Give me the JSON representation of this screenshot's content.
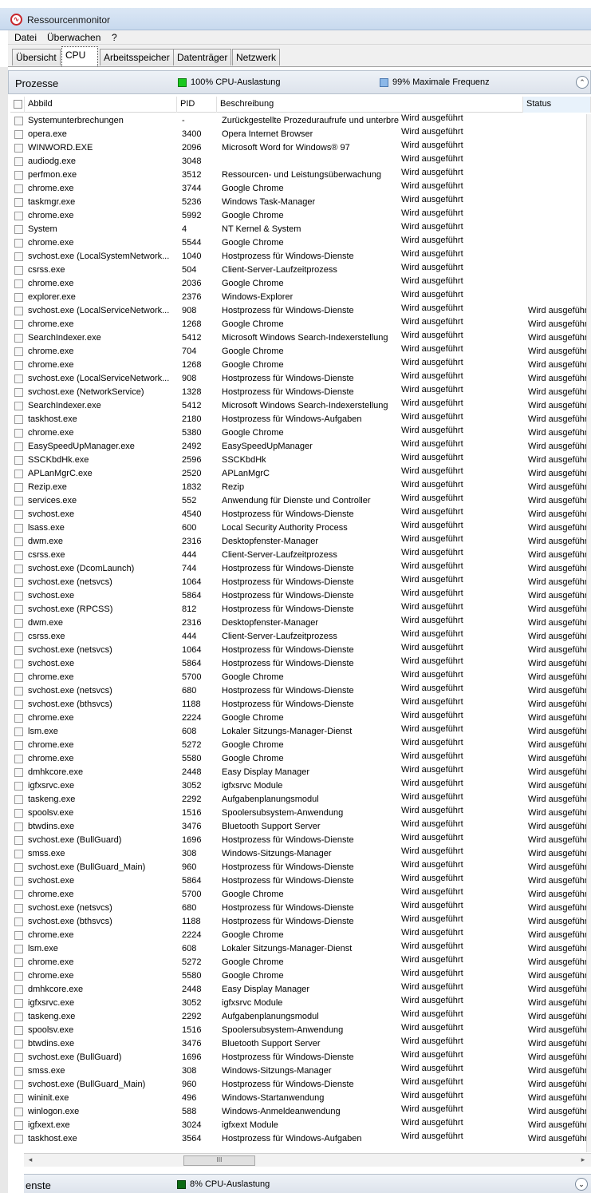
{
  "window": {
    "title": "Ressourcenmonitor"
  },
  "menu": [
    "Datei",
    "Überwachen",
    "?"
  ],
  "tabs": [
    "Übersicht",
    "CPU",
    "Arbeitsspeicher",
    "Datenträger",
    "Netzwerk"
  ],
  "active_tab": "CPU",
  "processes_section": {
    "title": "Prozesse",
    "cpu_usage": "100% CPU-Auslastung",
    "cpu_color": "#19c81e",
    "max_freq": "99% Maximale Frequenz",
    "freq_color": "#8cb8e8"
  },
  "columns": {
    "image": "Abbild",
    "pid": "PID",
    "description": "Beschreibung",
    "status": "Status"
  },
  "rows": [
    {
      "name": "Systemunterbrechungen",
      "pid": "-",
      "desc": "Zurückgestellte Prozeduraufrufe und unterbrechungsroutinen",
      "s1": "Wird ausgeführt",
      "s2": ""
    },
    {
      "name": "opera.exe",
      "pid": "3400",
      "desc": "Opera Internet Browser",
      "s1": "Wird ausgeführt",
      "s2": ""
    },
    {
      "name": "WINWORD.EXE",
      "pid": "2096",
      "desc": "Microsoft Word for Windows® 97",
      "s1": "Wird ausgeführt",
      "s2": ""
    },
    {
      "name": "audiodg.exe",
      "pid": "3048",
      "desc": "",
      "s1": "Wird ausgeführt",
      "s2": ""
    },
    {
      "name": "perfmon.exe",
      "pid": "3512",
      "desc": "Ressourcen- und Leistungsüberwachung",
      "s1": "Wird ausgeführt",
      "s2": ""
    },
    {
      "name": "chrome.exe",
      "pid": "3744",
      "desc": "Google Chrome",
      "s1": "Wird ausgeführt",
      "s2": ""
    },
    {
      "name": "taskmgr.exe",
      "pid": "5236",
      "desc": "Windows Task-Manager",
      "s1": "Wird ausgeführt",
      "s2": ""
    },
    {
      "name": "chrome.exe",
      "pid": "5992",
      "desc": "Google Chrome",
      "s1": "Wird ausgeführt",
      "s2": ""
    },
    {
      "name": "System",
      "pid": "4",
      "desc": "NT Kernel & System",
      "s1": "Wird ausgeführt",
      "s2": ""
    },
    {
      "name": "chrome.exe",
      "pid": "5544",
      "desc": "Google Chrome",
      "s1": "Wird ausgeführt",
      "s2": ""
    },
    {
      "name": "svchost.exe (LocalSystemNetwork...",
      "pid": "1040",
      "desc": "Hostprozess für Windows-Dienste",
      "s1": "Wird ausgeführt",
      "s2": ""
    },
    {
      "name": "csrss.exe",
      "pid": "504",
      "desc": "Client-Server-Laufzeitprozess",
      "s1": "Wird ausgeführt",
      "s2": ""
    },
    {
      "name": "chrome.exe",
      "pid": "2036",
      "desc": "Google Chrome",
      "s1": "Wird ausgeführt",
      "s2": ""
    },
    {
      "name": "explorer.exe",
      "pid": "2376",
      "desc": "Windows-Explorer",
      "s1": "Wird ausgeführt",
      "s2": ""
    },
    {
      "name": "svchost.exe (LocalServiceNetwork...",
      "pid": "908",
      "desc": "Hostprozess für Windows-Dienste",
      "s1": "Wird ausgeführt",
      "s2": "Wird ausgeführt"
    },
    {
      "name": "chrome.exe",
      "pid": "1268",
      "desc": "Google Chrome",
      "s1": "Wird ausgeführt",
      "s2": "Wird ausgeführt"
    },
    {
      "name": "SearchIndexer.exe",
      "pid": "5412",
      "desc": "Microsoft Windows Search-Indexerstellung",
      "s1": "Wird ausgeführt",
      "s2": "Wird ausgeführt"
    },
    {
      "name": "chrome.exe",
      "pid": "704",
      "desc": "Google Chrome",
      "s1": "Wird ausgeführt",
      "s2": "Wird ausgeführt"
    },
    {
      "name": "chrome.exe",
      "pid": "1268",
      "desc": "Google Chrome",
      "s1": "Wird ausgeführt",
      "s2": "Wird ausgeführt"
    },
    {
      "name": "svchost.exe (LocalServiceNetwork...",
      "pid": "908",
      "desc": "Hostprozess für Windows-Dienste",
      "s1": "Wird ausgeführt",
      "s2": "Wird ausgeführt"
    },
    {
      "name": "svchost.exe (NetworkService)",
      "pid": "1328",
      "desc": "Hostprozess für Windows-Dienste",
      "s1": "Wird ausgeführt",
      "s2": "Wird ausgeführt"
    },
    {
      "name": "SearchIndexer.exe",
      "pid": "5412",
      "desc": "Microsoft Windows Search-Indexerstellung",
      "s1": "Wird ausgeführt",
      "s2": "Wird ausgeführt"
    },
    {
      "name": "taskhost.exe",
      "pid": "2180",
      "desc": "Hostprozess für Windows-Aufgaben",
      "s1": "Wird ausgeführt",
      "s2": "Wird ausgeführt"
    },
    {
      "name": "chrome.exe",
      "pid": "5380",
      "desc": "Google Chrome",
      "s1": "Wird ausgeführt",
      "s2": "Wird ausgeführt"
    },
    {
      "name": "EasySpeedUpManager.exe",
      "pid": "2492",
      "desc": "EasySpeedUpManager",
      "s1": "Wird ausgeführt",
      "s2": "Wird ausgeführt"
    },
    {
      "name": "SSCKbdHk.exe",
      "pid": "2596",
      "desc": "SSCKbdHk",
      "s1": "Wird ausgeführt",
      "s2": "Wird ausgeführt"
    },
    {
      "name": "APLanMgrC.exe",
      "pid": "2520",
      "desc": "APLanMgrC",
      "s1": "Wird ausgeführt",
      "s2": "Wird ausgeführt"
    },
    {
      "name": "Rezip.exe",
      "pid": "1832",
      "desc": "Rezip",
      "s1": "Wird ausgeführt",
      "s2": "Wird ausgeführt"
    },
    {
      "name": "services.exe",
      "pid": "552",
      "desc": "Anwendung für Dienste und Controller",
      "s1": "Wird ausgeführt",
      "s2": "Wird ausgeführt"
    },
    {
      "name": "svchost.exe",
      "pid": "4540",
      "desc": "Hostprozess für Windows-Dienste",
      "s1": "Wird ausgeführt",
      "s2": "Wird ausgeführt"
    },
    {
      "name": "lsass.exe",
      "pid": "600",
      "desc": "Local Security Authority Process",
      "s1": "Wird ausgeführt",
      "s2": "Wird ausgeführt"
    },
    {
      "name": "dwm.exe",
      "pid": "2316",
      "desc": "Desktopfenster-Manager",
      "s1": "Wird ausgeführt",
      "s2": "Wird ausgeführt"
    },
    {
      "name": "csrss.exe",
      "pid": "444",
      "desc": "Client-Server-Laufzeitprozess",
      "s1": "Wird ausgeführt",
      "s2": "Wird ausgeführt"
    },
    {
      "name": "svchost.exe (DcomLaunch)",
      "pid": "744",
      "desc": "Hostprozess für Windows-Dienste",
      "s1": "Wird ausgeführt",
      "s2": "Wird ausgeführt"
    },
    {
      "name": "svchost.exe (netsvcs)",
      "pid": "1064",
      "desc": "Hostprozess für Windows-Dienste",
      "s1": "Wird ausgeführt",
      "s2": "Wird ausgeführt"
    },
    {
      "name": "svchost.exe",
      "pid": "5864",
      "desc": "Hostprozess für Windows-Dienste",
      "s1": "Wird ausgeführt",
      "s2": "Wird ausgeführt"
    },
    {
      "name": "svchost.exe (RPCSS)",
      "pid": "812",
      "desc": "Hostprozess für Windows-Dienste",
      "s1": "Wird ausgeführt",
      "s2": "Wird ausgeführt"
    },
    {
      "name": "dwm.exe",
      "pid": "2316",
      "desc": "Desktopfenster-Manager",
      "s1": "Wird ausgeführt",
      "s2": "Wird ausgeführt"
    },
    {
      "name": "csrss.exe",
      "pid": "444",
      "desc": "Client-Server-Laufzeitprozess",
      "s1": "Wird ausgeführt",
      "s2": "Wird ausgeführt"
    },
    {
      "name": "svchost.exe (netsvcs)",
      "pid": "1064",
      "desc": "Hostprozess für Windows-Dienste",
      "s1": "Wird ausgeführt",
      "s2": "Wird ausgeführt"
    },
    {
      "name": "svchost.exe",
      "pid": "5864",
      "desc": "Hostprozess für Windows-Dienste",
      "s1": "Wird ausgeführt",
      "s2": "Wird ausgeführt"
    },
    {
      "name": "chrome.exe",
      "pid": "5700",
      "desc": "Google Chrome",
      "s1": "Wird ausgeführt",
      "s2": "Wird ausgeführt"
    },
    {
      "name": "svchost.exe (netsvcs)",
      "pid": "680",
      "desc": "Hostprozess für Windows-Dienste",
      "s1": "Wird ausgeführt",
      "s2": "Wird ausgeführt"
    },
    {
      "name": "svchost.exe (bthsvcs)",
      "pid": "1188",
      "desc": "Hostprozess für Windows-Dienste",
      "s1": "Wird ausgeführt",
      "s2": "Wird ausgeführt"
    },
    {
      "name": "chrome.exe",
      "pid": "2224",
      "desc": "Google Chrome",
      "s1": "Wird ausgeführt",
      "s2": "Wird ausgeführt"
    },
    {
      "name": "lsm.exe",
      "pid": "608",
      "desc": "Lokaler Sitzungs-Manager-Dienst",
      "s1": "Wird ausgeführt",
      "s2": "Wird ausgeführt"
    },
    {
      "name": "chrome.exe",
      "pid": "5272",
      "desc": "Google Chrome",
      "s1": "Wird ausgeführt",
      "s2": "Wird ausgeführt"
    },
    {
      "name": "chrome.exe",
      "pid": "5580",
      "desc": "Google Chrome",
      "s1": "Wird ausgeführt",
      "s2": "Wird ausgeführt"
    },
    {
      "name": "dmhkcore.exe",
      "pid": "2448",
      "desc": "Easy Display Manager",
      "s1": "Wird ausgeführt",
      "s2": "Wird ausgeführt"
    },
    {
      "name": "igfxsrvc.exe",
      "pid": "3052",
      "desc": "igfxsrvc Module",
      "s1": "Wird ausgeführt",
      "s2": "Wird ausgeführt"
    },
    {
      "name": "taskeng.exe",
      "pid": "2292",
      "desc": "Aufgabenplanungsmodul",
      "s1": "Wird ausgeführt",
      "s2": "Wird ausgeführt"
    },
    {
      "name": "spoolsv.exe",
      "pid": "1516",
      "desc": "Spoolersubsystem-Anwendung",
      "s1": "Wird ausgeführt",
      "s2": "Wird ausgeführt"
    },
    {
      "name": "btwdins.exe",
      "pid": "3476",
      "desc": "Bluetooth Support Server",
      "s1": "Wird ausgeführt",
      "s2": "Wird ausgeführt"
    },
    {
      "name": "svchost.exe (BullGuard)",
      "pid": "1696",
      "desc": "Hostprozess für Windows-Dienste",
      "s1": "Wird ausgeführt",
      "s2": "Wird ausgeführt"
    },
    {
      "name": "smss.exe",
      "pid": "308",
      "desc": "Windows-Sitzungs-Manager",
      "s1": "Wird ausgeführt",
      "s2": "Wird ausgeführt"
    },
    {
      "name": "svchost.exe (BullGuard_Main)",
      "pid": "960",
      "desc": "Hostprozess für Windows-Dienste",
      "s1": "Wird ausgeführt",
      "s2": "Wird ausgeführt"
    },
    {
      "name": "svchost.exe",
      "pid": "5864",
      "desc": "Hostprozess für Windows-Dienste",
      "s1": "Wird ausgeführt",
      "s2": "Wird ausgeführt"
    },
    {
      "name": "chrome.exe",
      "pid": "5700",
      "desc": "Google Chrome",
      "s1": "Wird ausgeführt",
      "s2": "Wird ausgeführt"
    },
    {
      "name": "svchost.exe (netsvcs)",
      "pid": "680",
      "desc": "Hostprozess für Windows-Dienste",
      "s1": "Wird ausgeführt",
      "s2": "Wird ausgeführt"
    },
    {
      "name": "svchost.exe (bthsvcs)",
      "pid": "1188",
      "desc": "Hostprozess für Windows-Dienste",
      "s1": "Wird ausgeführt",
      "s2": "Wird ausgeführt"
    },
    {
      "name": "chrome.exe",
      "pid": "2224",
      "desc": "Google Chrome",
      "s1": "Wird ausgeführt",
      "s2": "Wird ausgeführt"
    },
    {
      "name": "lsm.exe",
      "pid": "608",
      "desc": "Lokaler Sitzungs-Manager-Dienst",
      "s1": "Wird ausgeführt",
      "s2": "Wird ausgeführt"
    },
    {
      "name": "chrome.exe",
      "pid": "5272",
      "desc": "Google Chrome",
      "s1": "Wird ausgeführt",
      "s2": "Wird ausgeführt"
    },
    {
      "name": "chrome.exe",
      "pid": "5580",
      "desc": "Google Chrome",
      "s1": "Wird ausgeführt",
      "s2": "Wird ausgeführt"
    },
    {
      "name": "dmhkcore.exe",
      "pid": "2448",
      "desc": "Easy Display Manager",
      "s1": "Wird ausgeführt",
      "s2": "Wird ausgeführt"
    },
    {
      "name": "igfxsrvc.exe",
      "pid": "3052",
      "desc": "igfxsrvc Module",
      "s1": "Wird ausgeführt",
      "s2": "Wird ausgeführt"
    },
    {
      "name": "taskeng.exe",
      "pid": "2292",
      "desc": "Aufgabenplanungsmodul",
      "s1": "Wird ausgeführt",
      "s2": "Wird ausgeführt"
    },
    {
      "name": "spoolsv.exe",
      "pid": "1516",
      "desc": "Spoolersubsystem-Anwendung",
      "s1": "Wird ausgeführt",
      "s2": "Wird ausgeführt"
    },
    {
      "name": "btwdins.exe",
      "pid": "3476",
      "desc": "Bluetooth Support Server",
      "s1": "Wird ausgeführt",
      "s2": "Wird ausgeführt"
    },
    {
      "name": "svchost.exe (BullGuard)",
      "pid": "1696",
      "desc": "Hostprozess für Windows-Dienste",
      "s1": "Wird ausgeführt",
      "s2": "Wird ausgeführt"
    },
    {
      "name": "smss.exe",
      "pid": "308",
      "desc": "Windows-Sitzungs-Manager",
      "s1": "Wird ausgeführt",
      "s2": "Wird ausgeführt"
    },
    {
      "name": "svchost.exe (BullGuard_Main)",
      "pid": "960",
      "desc": "Hostprozess für Windows-Dienste",
      "s1": "Wird ausgeführt",
      "s2": "Wird ausgeführt"
    },
    {
      "name": "wininit.exe",
      "pid": "496",
      "desc": "Windows-Startanwendung",
      "s1": "Wird ausgeführt",
      "s2": "Wird ausgeführt"
    },
    {
      "name": "winlogon.exe",
      "pid": "588",
      "desc": "Windows-Anmeldeanwendung",
      "s1": "Wird ausgeführt",
      "s2": "Wird ausgeführt"
    },
    {
      "name": "igfxext.exe",
      "pid": "3024",
      "desc": "igfxext Module",
      "s1": "Wird ausgeführt",
      "s2": "Wird ausgeführt"
    },
    {
      "name": "taskhost.exe",
      "pid": "3564",
      "desc": "Hostprozess für Windows-Aufgaben",
      "s1": "Wird ausgeführt",
      "s2": "Wird ausgeführt"
    }
  ],
  "bottom_section": {
    "title": "enste",
    "cpu_usage": "8% CPU-Auslastung",
    "cpu_color": "#0b6a12"
  },
  "scroll": {
    "thumb_label": "III"
  }
}
